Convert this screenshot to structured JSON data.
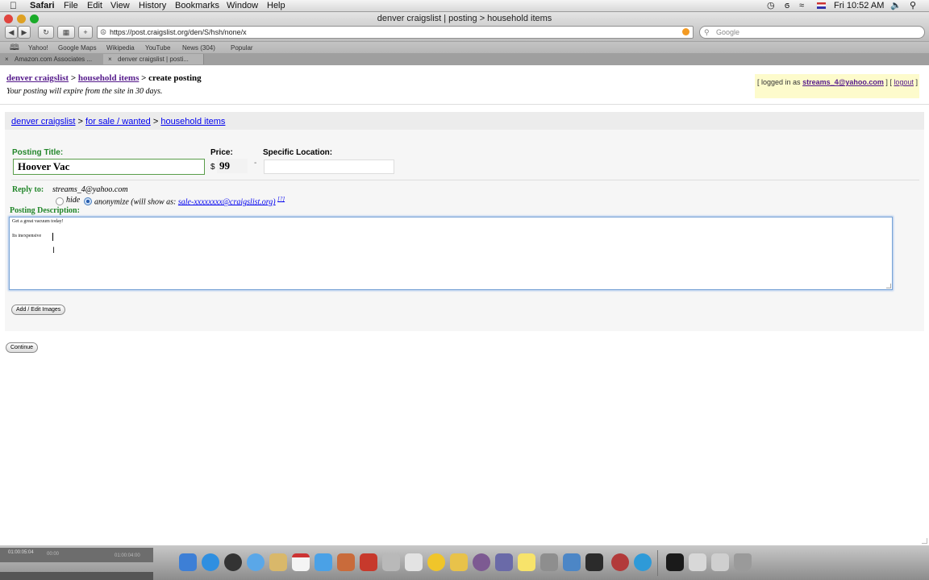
{
  "menubar": {
    "apple": "",
    "app_name": "Safari",
    "menus": [
      "File",
      "Edit",
      "View",
      "History",
      "Bookmarks",
      "Window",
      "Help"
    ],
    "clock": "Fri 10:52 AM"
  },
  "window": {
    "title": "denver craigslist | posting > household items",
    "url": "https://post.craigslist.org/den/S/hsh/none/x",
    "search_placeholder": "Google"
  },
  "bookmarks": [
    "Yahoo!",
    "Google Maps",
    "Wikipedia",
    "YouTube",
    "News (304)",
    "Popular"
  ],
  "tabs": [
    "Amazon.com Associates ...",
    "denver craigslist | posti..."
  ],
  "page": {
    "crumb1": "denver craigslist",
    "crumb2": "household items",
    "crumb3": "create posting",
    "sep": ">",
    "expire_note": "Your posting will expire from the site in 30 days.",
    "login_prefix": "[ logged in as",
    "login_email": "streams_4@yahoo.com",
    "login_mid": "] [",
    "logout": "logout",
    "login_suffix": "]",
    "nav1": "denver craigslist",
    "nav2": "for sale / wanted",
    "nav3": "household items",
    "title_label": "Posting Title:",
    "title_value": "Hoover Vac",
    "price_label": "Price:",
    "price_currency": "$",
    "price_value": "99",
    "price_dash": "-",
    "location_label": "Specific Location:",
    "location_value": "",
    "reply_label": "Reply to:",
    "reply_email": "streams_4@yahoo.com",
    "hide_label": "hide",
    "anonymize_label": "anonymize (will show as:",
    "anon_email": "sale-xxxxxxxx@craigslist.org)",
    "help_mark": "[?]",
    "desc_label": "Posting Description:",
    "desc_line1": "Get a great vacuum today!",
    "desc_line2": "Its inexpensive",
    "add_images": "Add / Edit Images",
    "continue": "Continue"
  },
  "dock": {
    "timecode_left": "01:00:05:04",
    "timecode_mid": "00:00",
    "timecode_right": "01:00:04:00"
  },
  "colors": {
    "label_green": "#22862a",
    "link_blue": "#0000ee",
    "link_visited": "#551a8b",
    "focus_blue": "#7aa4d6",
    "login_bg": "#fdfbcc"
  }
}
